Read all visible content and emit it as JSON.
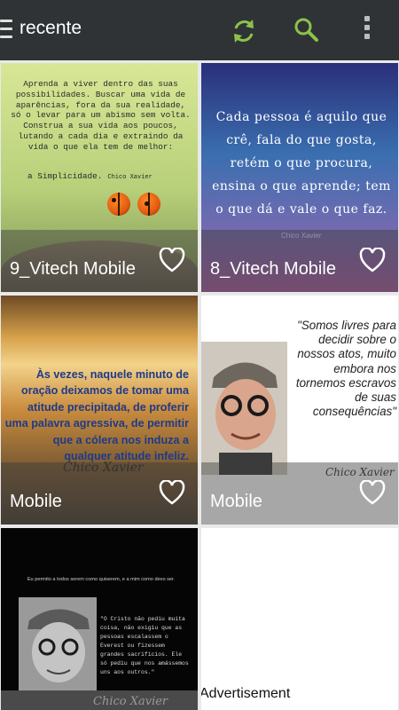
{
  "appbar": {
    "title": "recente",
    "icons": [
      "menu-icon",
      "refresh-icon",
      "search-icon",
      "more-options-icon"
    ],
    "accent": "#8bc34a"
  },
  "tiles": [
    {
      "caption": "9_Vitech Mobile",
      "quote": "Aprenda a viver dentro das suas possibilidades. Buscar uma vida de aparências, fora da sua realidade, só o levar para um abismo sem volta. Construa a sua vida aos poucos, lutando a cada dia e extraindo da vida o que ela tem de melhor:",
      "closing": "a Simplicidade.",
      "author": "Chico Xavier"
    },
    {
      "caption": "8_Vitech Mobile",
      "quote": "Cada pessoa é aquilo que crê, fala do que gosta, retém o que procura, ensina o que aprende; tem o que dá e vale o que faz.",
      "author": "Chico Xavier"
    },
    {
      "caption": "Mobile",
      "quote": "Às vezes, naquele minuto de oração deixamos de tomar uma atitude precipitada, de proferir uma palavra agressiva, de permitir que a cólera nos induza a qualquer atitude infeliz.",
      "author": "Chico Xavier"
    },
    {
      "caption": "Mobile",
      "quote": "\"Somos livres para decidir sobre o nossos atos, muito embora nos tornemos escravos de suas consequências\"",
      "author": "Chico Xavier"
    },
    {
      "header": "Eu permito a todos serem como quiserem, e a mim como devo ser.",
      "quote": "\"O Cristo não pediu muita coisa, não exigiu que as pessoas escalassem o Everest ou fizessem grandes sacrifícios. Ele só pediu que nos amássemos uns aos outros.\"",
      "author": "Chico Xavier"
    }
  ],
  "ad": {
    "label": "Advertisement"
  }
}
